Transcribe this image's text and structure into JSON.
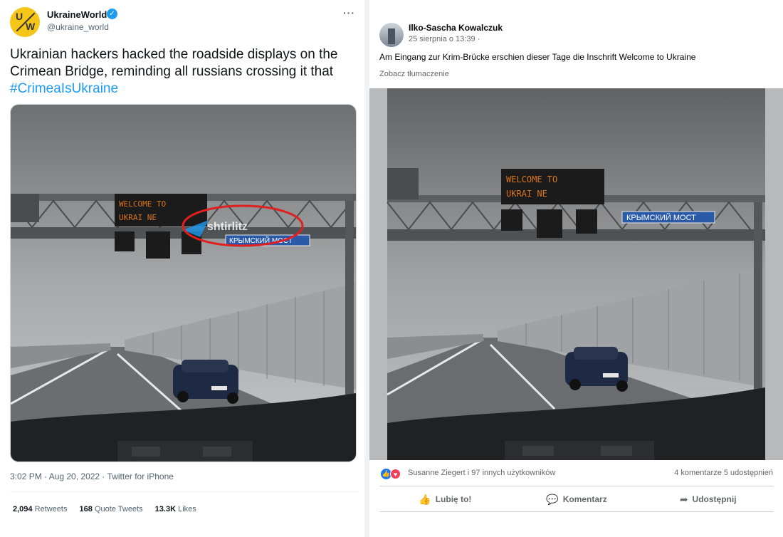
{
  "twitter": {
    "avatar_letters": [
      "U",
      "W"
    ],
    "name": "UkraineWorld",
    "handle": "@ukraine_world",
    "more": "···",
    "text": "Ukrainian hackers hacked the roadside displays on the Crimean Bridge, reminding all russians crossing it that",
    "hashtag": "#CrimeaIsUkraine",
    "image_overlays": {
      "sign_line1": "WELCOME      TO",
      "sign_line2": "UKRAI NE",
      "bridge_sign": "КРЫМСКИЙ МОСТ",
      "watermark": "shtirlitz"
    },
    "meta": "3:02 PM · Aug 20, 2022 · Twitter for iPhone",
    "stats": [
      {
        "count": "2,094",
        "label": "Retweets"
      },
      {
        "count": "168",
        "label": "Quote Tweets"
      },
      {
        "count": "13.3K",
        "label": "Likes"
      }
    ]
  },
  "facebook": {
    "name": "Ilko-Sascha Kowalczuk",
    "time": "25 sierpnia o 13:39 ·",
    "text": "Am Eingang zur Krim-Brücke erschien dieser Tage die Inschrift Welcome to Ukraine",
    "translate": "Zobacz tłumaczenie",
    "image_overlays": {
      "sign_line1": "WELCOME      TO",
      "sign_line2": "UKRAI NE",
      "bridge_sign": "КРЫМСКИЙ МОСТ"
    },
    "reactions_text": "Susanne Ziegert i 97 innych użytkowników",
    "counts": "4 komentarze  5 udostępnień",
    "actions": [
      {
        "icon": "like-icon",
        "label": "Lubię to!"
      },
      {
        "icon": "comment-icon",
        "label": "Komentarz"
      },
      {
        "icon": "share-icon",
        "label": "Udostępnij"
      }
    ]
  },
  "colors": {
    "twitter_blue": "#1d9bf0",
    "fb_blue": "#1877f2",
    "highlight_red": "#e02020",
    "led_orange": "#d9741c"
  }
}
